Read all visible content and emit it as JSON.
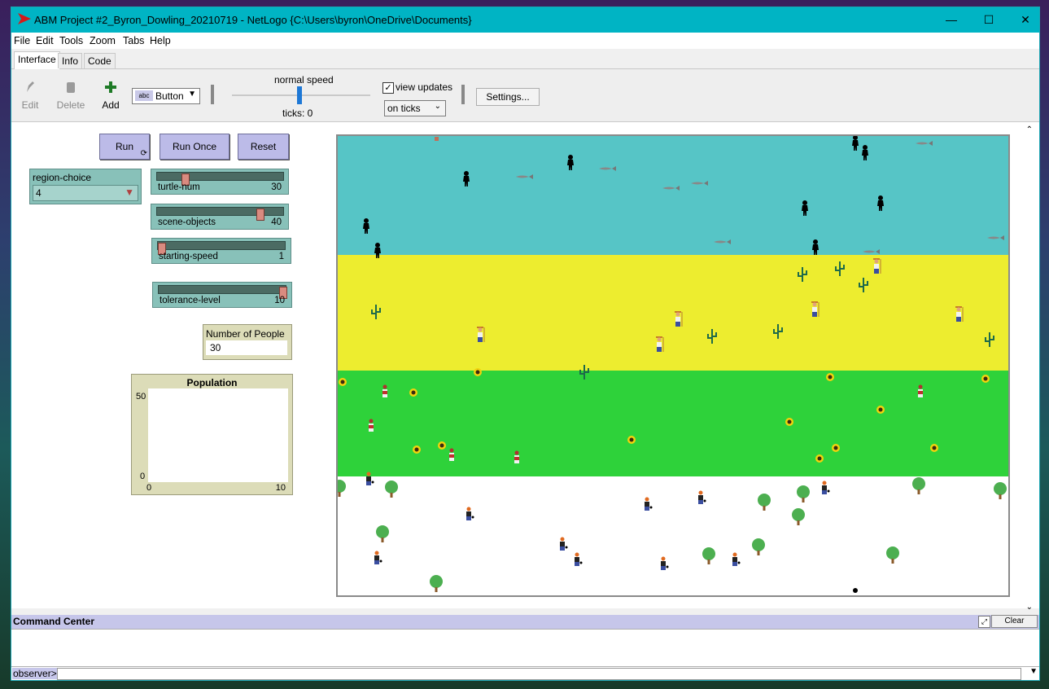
{
  "window": {
    "title": "ABM Project #2_Byron_Dowling_20210719 - NetLogo {C:\\Users\\byron\\OneDrive\\Documents}",
    "minimize": "—",
    "maximize": "☐",
    "close": "✕"
  },
  "menu": [
    "File",
    "Edit",
    "Tools",
    "Zoom",
    "Tabs",
    "Help"
  ],
  "tabs": [
    "Interface",
    "Info",
    "Code"
  ],
  "toolbar": {
    "edit": "Edit",
    "delete": "Delete",
    "add": "Add",
    "widget_type": "Button",
    "speed_label": "normal speed",
    "ticks": "ticks: 0",
    "view_updates_label": "view updates",
    "view_updates_checked": true,
    "update_mode": "on ticks",
    "settings": "Settings..."
  },
  "widgets": {
    "run": "Run",
    "run_once": "Run Once",
    "reset": "Reset",
    "region_choice": {
      "label": "region-choice",
      "value": "4"
    },
    "sliders": [
      {
        "name": "turtle-num",
        "value": "30",
        "fraction": 0.23
      },
      {
        "name": "scene-objects",
        "value": "40",
        "fraction": 0.82
      },
      {
        "name": "starting-speed",
        "value": "1",
        "fraction": 0.0
      },
      {
        "name": "tolerance-level",
        "value": "10",
        "fraction": 1.0
      }
    ],
    "monitor": {
      "label": "Number of People",
      "value": "30"
    },
    "plot": {
      "title": "Population",
      "ymax": "50",
      "ymin": "0",
      "xmin": "0",
      "xmax": "10"
    }
  },
  "world": {
    "bands": [
      {
        "color": "#56c5c6"
      },
      {
        "color": "#eded2f"
      },
      {
        "color": "#2ed23a"
      },
      {
        "color": "#ffffff"
      }
    ]
  },
  "command_center": {
    "title": "Command Center",
    "clear": "Clear",
    "prompt": "observer>"
  }
}
